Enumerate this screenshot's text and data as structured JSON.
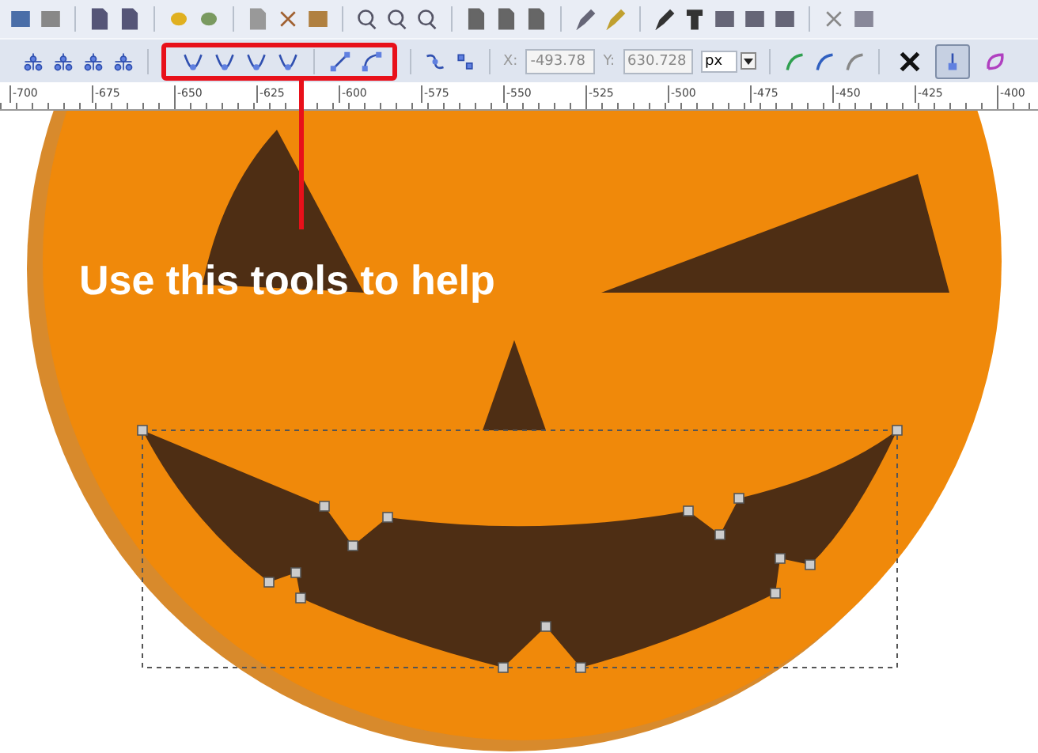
{
  "node_toolbar": {
    "x_label": "X:",
    "x_value": "-493.78",
    "y_label": "Y:",
    "y_value": "630.728",
    "unit": "px",
    "toggles": [
      {
        "on": false
      },
      {
        "on": true
      },
      {
        "on": false
      }
    ]
  },
  "ruler": {
    "labels": [
      "-700",
      "-675",
      "-650",
      "-625",
      "-600",
      "-575",
      "-550",
      "-525",
      "-500",
      "-475",
      "-450",
      "-425",
      "-400"
    ]
  },
  "annotation": {
    "text": "Use this tools to help"
  }
}
